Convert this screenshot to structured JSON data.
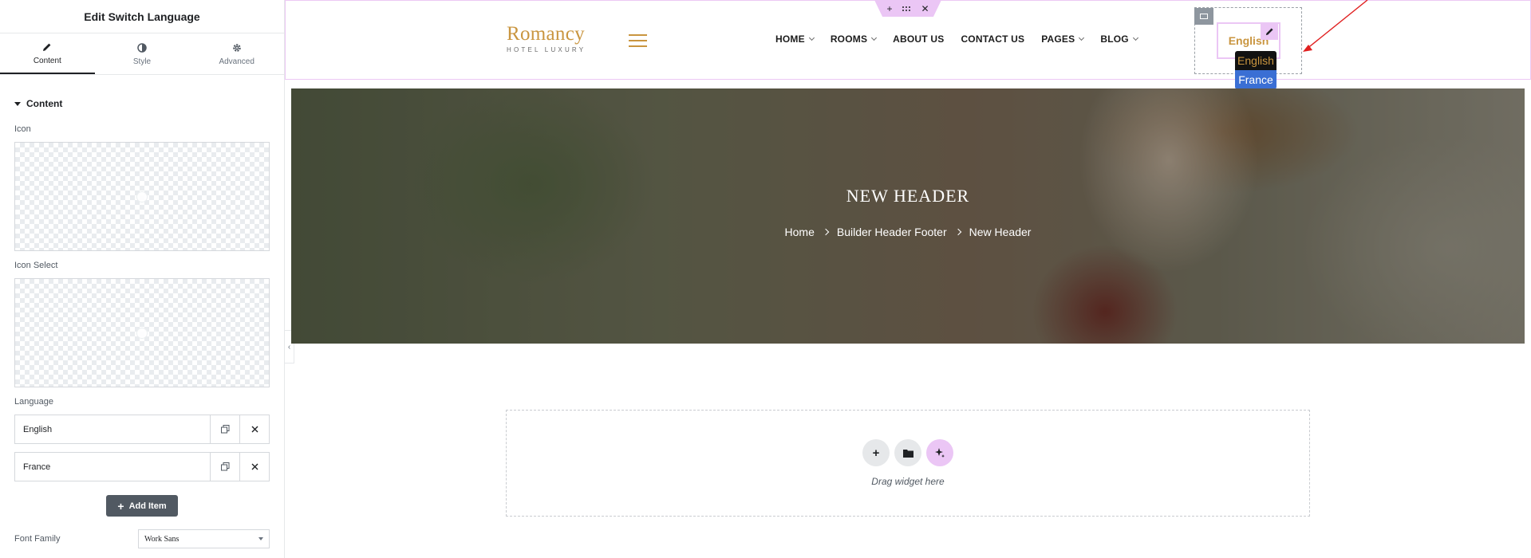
{
  "panel": {
    "title": "Edit Switch Language",
    "tabs": [
      {
        "label": "Content",
        "icon": "pencil-icon",
        "active": true
      },
      {
        "label": "Style",
        "icon": "half-circle-icon",
        "active": false
      },
      {
        "label": "Advanced",
        "icon": "gear-icon",
        "active": false
      }
    ],
    "section_title": "Content",
    "fields": {
      "icon_label": "Icon",
      "icon_select_label": "Icon Select",
      "language_label": "Language",
      "languages": [
        "English",
        "France"
      ],
      "add_item_label": "Add Item",
      "font_family_label": "Font Family",
      "font_family_value": "Work Sans"
    }
  },
  "site": {
    "logo_name": "Romancy",
    "logo_tagline": "HOTEL LUXURY",
    "nav": [
      {
        "label": "HOME",
        "dropdown": true
      },
      {
        "label": "ROOMS",
        "dropdown": true
      },
      {
        "label": "ABOUT US",
        "dropdown": false
      },
      {
        "label": "CONTACT US",
        "dropdown": false
      },
      {
        "label": "PAGES",
        "dropdown": true
      },
      {
        "label": "BLOG",
        "dropdown": true
      }
    ],
    "language_current": "English",
    "language_options": [
      "English",
      "France"
    ]
  },
  "hero": {
    "title": "NEW HEADER",
    "breadcrumb": [
      "Home",
      "Builder Header Footer",
      "New Header"
    ]
  },
  "drop_zone": {
    "text": "Drag widget here"
  },
  "colors": {
    "brand_gold": "#c9953f",
    "editor_pink": "#ebc6f5",
    "panel_button": "#515962",
    "dropdown_highlight": "#3a6fd4",
    "annotation_red": "#e02020"
  }
}
